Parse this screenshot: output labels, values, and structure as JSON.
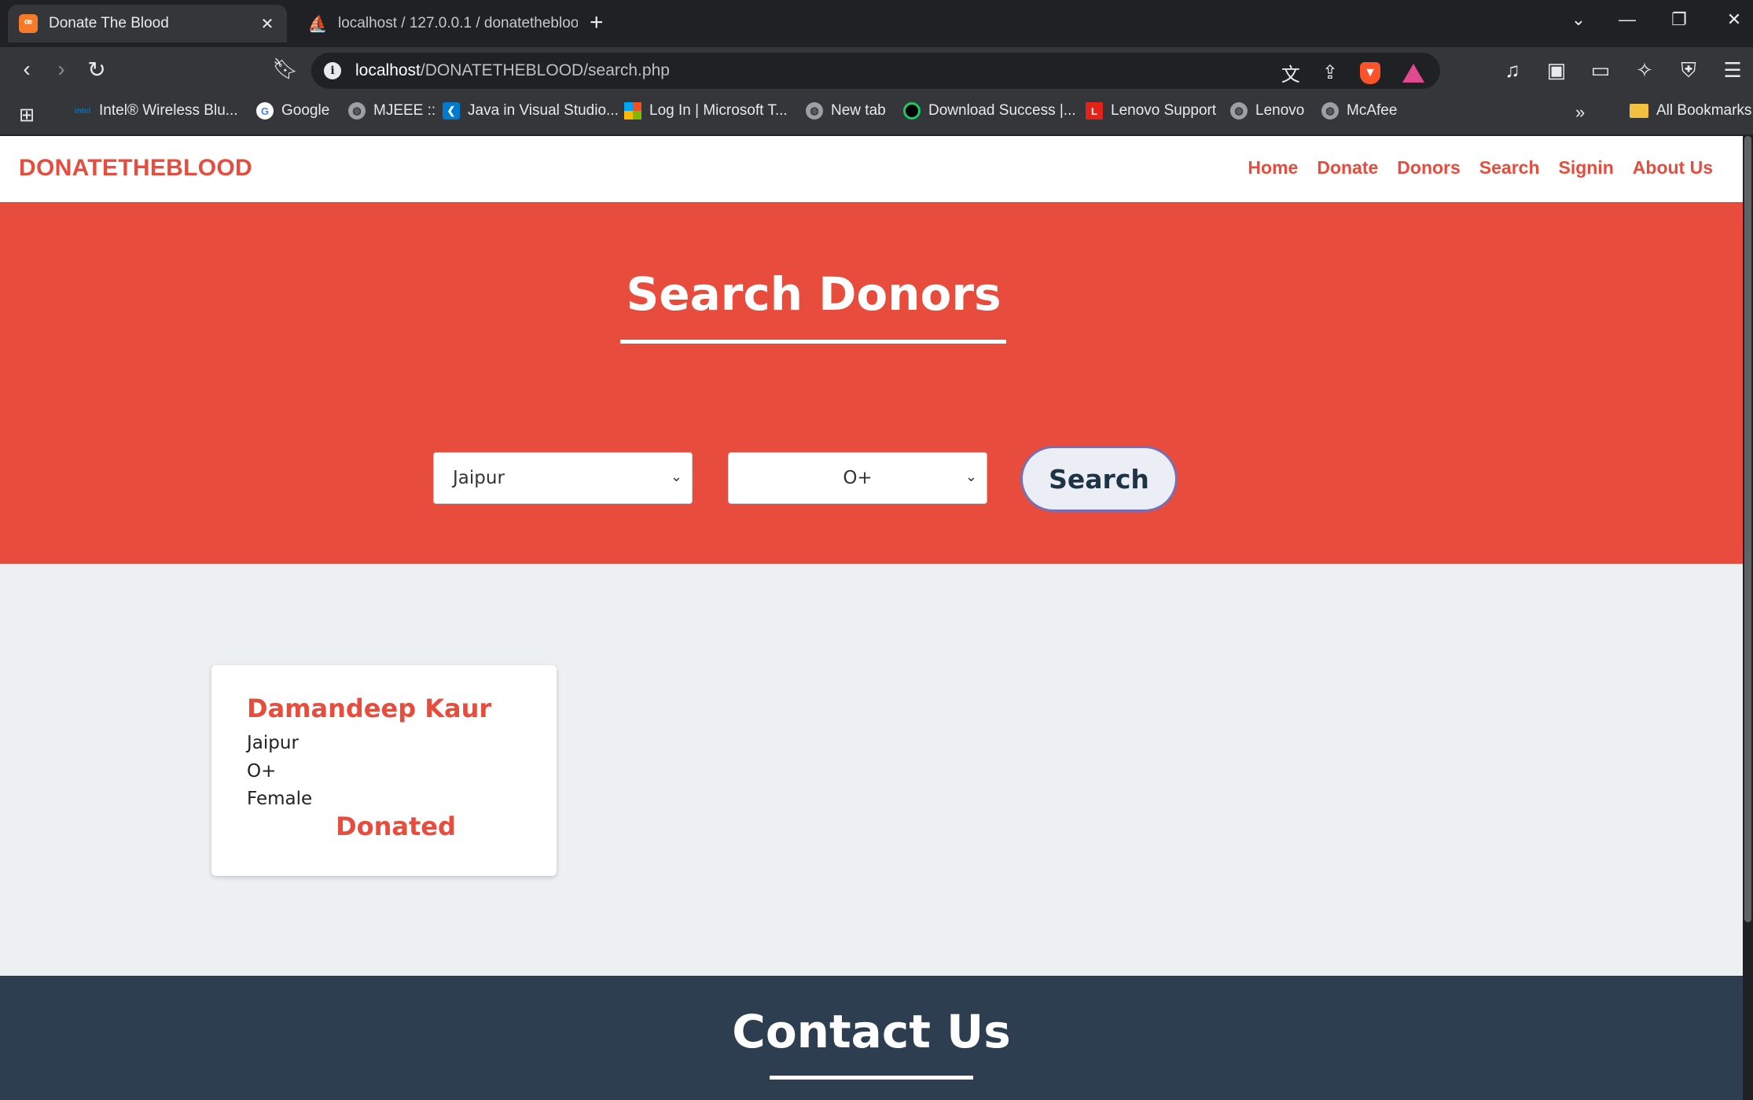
{
  "browser": {
    "tabs": [
      {
        "title": "Donate The Blood",
        "favicon": "xampp-icon",
        "active": true
      },
      {
        "title": "localhost / 127.0.0.1 / donatetheblood",
        "favicon": "phpmyadmin-icon",
        "active": false
      }
    ],
    "url_host": "localhost",
    "url_path": "/DONATETHEBLOOD/search.php",
    "bookmarks": [
      {
        "label": "Intel® Wireless Blu...",
        "icon": "intel-icon"
      },
      {
        "label": "Google",
        "icon": "google-icon"
      },
      {
        "label": "MJEEE ::",
        "icon": "globe-icon"
      },
      {
        "label": "Java in Visual Studio...",
        "icon": "vscode-icon"
      },
      {
        "label": "Log In | Microsoft T...",
        "icon": "microsoft-icon"
      },
      {
        "label": "New tab",
        "icon": "globe-icon"
      },
      {
        "label": "Download Success |...",
        "icon": "download-icon"
      },
      {
        "label": "Lenovo Support",
        "icon": "lenovo-icon"
      },
      {
        "label": "Lenovo",
        "icon": "globe-icon"
      },
      {
        "label": "McAfee",
        "icon": "globe-icon"
      }
    ],
    "all_bookmarks": "All Bookmarks"
  },
  "site": {
    "brand": "DONATETHEBLOOD",
    "nav": [
      "Home",
      "Donate",
      "Donors",
      "Search",
      "Signin",
      "About Us"
    ]
  },
  "hero": {
    "title": "Search Donors",
    "city_value": "Jaipur",
    "blood_group_value": "O+",
    "search_label": "Search"
  },
  "results": [
    {
      "name": "Damandeep Kaur",
      "city": "Jaipur",
      "blood_group": "O+",
      "gender": "Female",
      "status": "Donated"
    }
  ],
  "contact": {
    "title": "Contact Us"
  },
  "colors": {
    "primary": "#e74c3c",
    "footer": "#2c3e50",
    "background": "#ecf0f1"
  }
}
